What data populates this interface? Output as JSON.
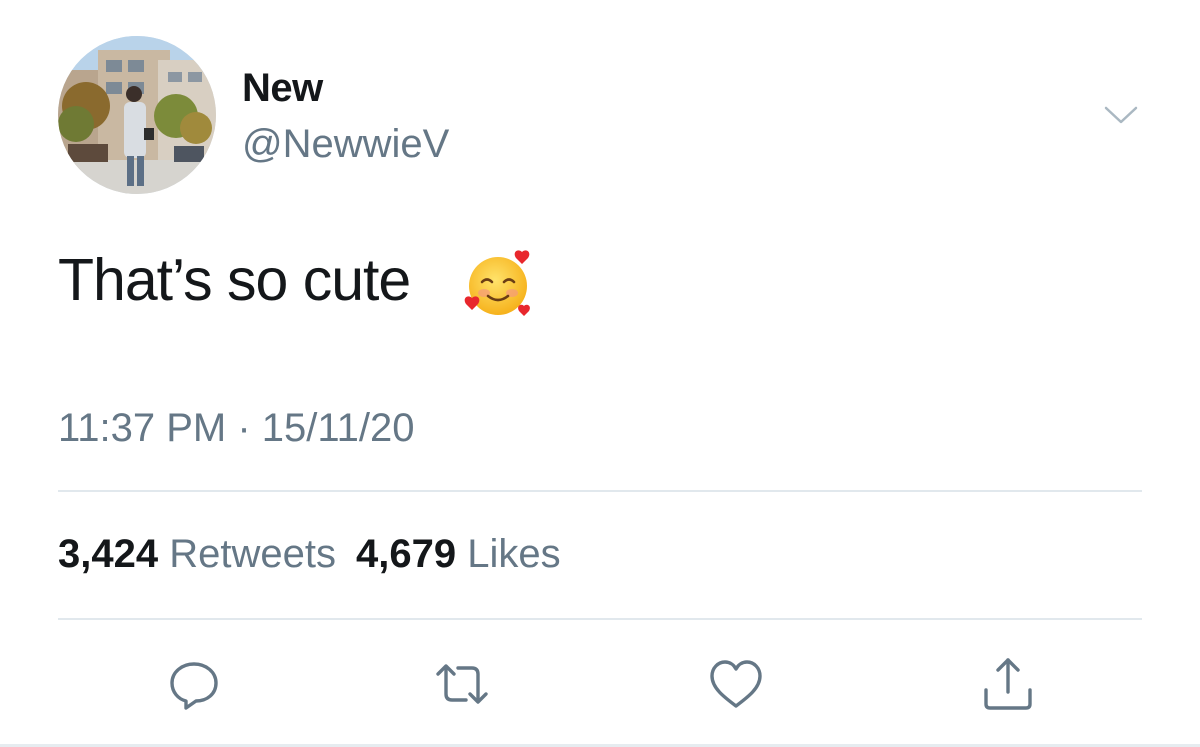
{
  "user": {
    "display_name": "New",
    "handle": "@NewwieV"
  },
  "tweet": {
    "text": "That’s so cute",
    "emoji": "smiling-face-with-hearts-icon",
    "time": "11:37 PM",
    "separator": " · ",
    "date": "15/11/20"
  },
  "stats": {
    "retweets_count": "3,424",
    "retweets_label": "Retweets",
    "likes_count": "4,679",
    "likes_label": "Likes"
  },
  "actions": [
    "reply-icon",
    "retweet-icon",
    "like-icon",
    "share-icon"
  ],
  "colors": {
    "text_primary": "#14171a",
    "text_secondary": "#657786",
    "icon": "#657786",
    "divider": "#e1e8ed"
  }
}
